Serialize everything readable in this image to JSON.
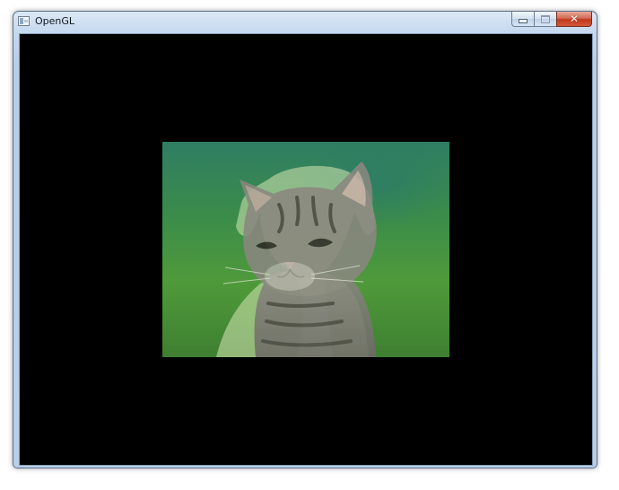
{
  "window": {
    "title": "OpenGL",
    "icon": "app-window-icon",
    "controls": {
      "minimize_icon": "minimize-icon",
      "maximize_icon": "maximize-icon",
      "close_icon": "close-icon",
      "close_glyph": "✕"
    }
  },
  "viewport": {
    "background": "#000000",
    "image_description_icon": "blended-texture"
  },
  "colors": {
    "close_button": "#c2381c",
    "titlebar": "#c5d8ee"
  }
}
